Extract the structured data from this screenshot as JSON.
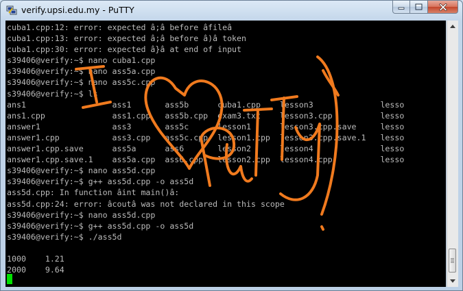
{
  "window": {
    "title": "verify.upsi.edu.my - PuTTY"
  },
  "terminal": {
    "lines": [
      "cuba1.cpp:12: error: expected â;â before âfileâ",
      "cuba1.cpp:13: error: expected â;â before â)â token",
      "cuba1.cpp:30: error: expected â}â at end of input",
      "s39406@verify:~$ nano cuba1.cpp",
      "s39406@verify:~$ nano ass5a.cpp",
      "s39406@verify:~$ nano ass5c.cpp",
      "s39406@verify:~$ ls",
      "ans1                  ass1       ass5b      cuba1.cpp    lesson3              lesso",
      "ans1.cpp              ass1.cpp   ass5b.cpp  exam3.txt    lesson3.cpp          lesso",
      "answer1               ass3       ass5c      lesson1      lesson3.cpp.save     lesso",
      "answer1.cpp           ass3.cpp   ass5c.cpp  lesson1.cpp  lesson3.cpp.save.1   lesso",
      "answer1.cpp.save      ass5a      ass6       lesson2      lesson4              lesso",
      "answer1.cpp.save.1    ass5a.cpp  ass6.cpp   lesson2.cpp  lesson4.cpp          lesso",
      "s39406@verify:~$ nano ass5d.cpp",
      "s39406@verify:~$ g++ ass5d.cpp -o ass5d",
      "ass5d.cpp: In function âint main()â:",
      "ass5d.cpp:24: error: âcoutâ was not declared in this scope",
      "s39406@verify:~$ nano ass5d.cpp",
      "s39406@verify:~$ g++ ass5d.cpp -o ass5d",
      "s39406@verify:~$ ./ass5d",
      "",
      "1000    1.21",
      "2000    9.64"
    ]
  },
  "annotation": {
    "handwritten_text": "I ♥ PuTTY",
    "color": "#f07a1e"
  },
  "colors": {
    "terminal_bg": "#000000",
    "terminal_fg": "#bbbbbb",
    "cursor": "#00e000",
    "close_button": "#c3452b"
  },
  "icons": {
    "app": "putty-icon",
    "minimize": "minimize-icon",
    "maximize": "maximize-icon",
    "close": "close-icon",
    "scroll_up": "arrow-up-icon",
    "scroll_down": "arrow-down-icon"
  }
}
